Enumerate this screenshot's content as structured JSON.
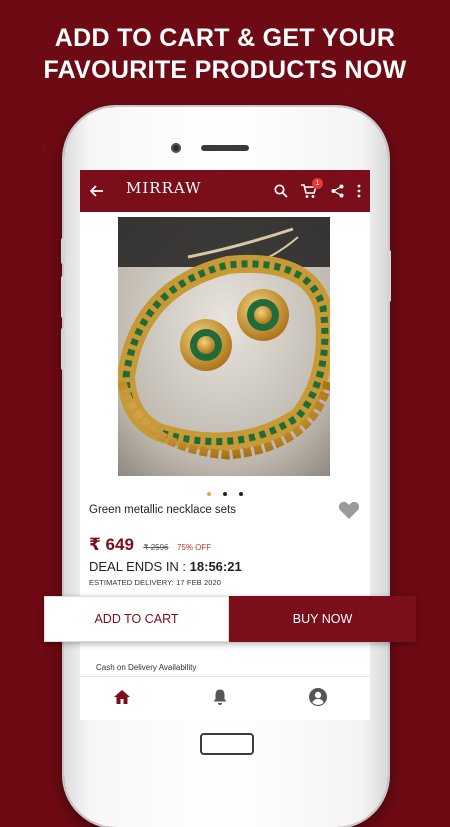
{
  "promo": {
    "line1": "ADD TO CART & GET YOUR",
    "line2": "FAVOURITE PRODUCTS NOW"
  },
  "appbar": {
    "logo": "MIRRAW",
    "cart_count": "1"
  },
  "product": {
    "title": "Green metallic necklace  sets",
    "price": "₹ 649",
    "original_price": "₹ 2596",
    "discount": "75% OFF",
    "deal_label": "DEAL ENDS IN : ",
    "deal_timer": "18:56:21",
    "estimated_delivery": "ESTIMATED DELIVERY: 17 FEB 2020",
    "image_carousel": {
      "total": 3,
      "active": 1
    }
  },
  "cod_text": "Cash on Delivery Availability",
  "actions": {
    "add_to_cart": "ADD TO CART",
    "buy_now": "BUY NOW"
  },
  "colors": {
    "brand": "#7a0e1a",
    "background": "#6e0a14"
  },
  "icons": [
    "back-arrow-icon",
    "search-icon",
    "cart-icon",
    "share-icon",
    "more-vert-icon",
    "heart-icon",
    "home-icon",
    "bell-icon",
    "account-icon"
  ]
}
